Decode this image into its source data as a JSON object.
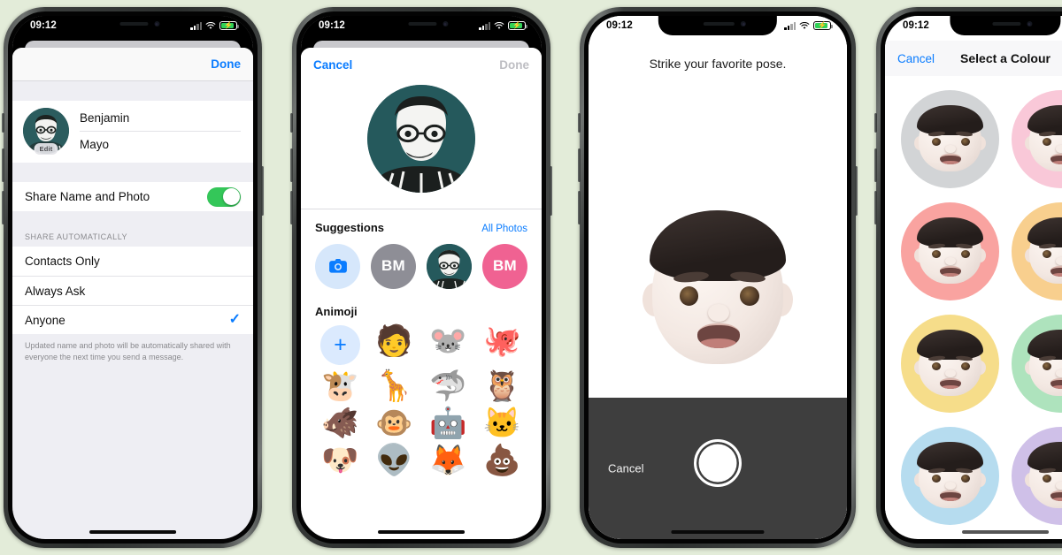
{
  "meta": {
    "background_color": "#e3ecd9"
  },
  "status_bar": {
    "time": "09:12",
    "signal": "signal-bars",
    "wifi": "wifi",
    "battery": "battery-charging"
  },
  "phone1": {
    "nav": {
      "done": "Done"
    },
    "profile": {
      "first_name": "Benjamin",
      "last_name": "Mayo",
      "edit_badge": "Edit"
    },
    "share_row": {
      "label": "Share Name and Photo",
      "toggle_state": "on",
      "toggle_color": "#34c759"
    },
    "section_header": "SHARE AUTOMATICALLY",
    "options": [
      {
        "label": "Contacts Only",
        "selected": false
      },
      {
        "label": "Always Ask",
        "selected": false
      },
      {
        "label": "Anyone",
        "selected": true
      }
    ],
    "footnote": "Updated name and photo will be automatically shared with everyone the next time you send a message."
  },
  "phone2": {
    "nav": {
      "cancel": "Cancel",
      "done": "Done"
    },
    "suggestions": {
      "title": "Suggestions",
      "link": "All Photos",
      "items": [
        {
          "type": "camera",
          "label": "",
          "color": "#d6e7fb"
        },
        {
          "type": "initials",
          "label": "BM",
          "color": "#8e8e96"
        },
        {
          "type": "photo",
          "label": "",
          "color": "#25595c"
        },
        {
          "type": "initials",
          "label": "BM",
          "color": "#f06292"
        }
      ]
    },
    "animoji": {
      "title": "Animoji",
      "items": [
        "plus",
        "🧑",
        "🐭",
        "🐙",
        "🐮",
        "🦒",
        "🦈",
        "🦉",
        "🐗",
        "🐵",
        "🤖",
        "🐱",
        "🐶",
        "👽",
        "🦊",
        "💩"
      ]
    }
  },
  "phone3": {
    "title": "Strike your favorite pose.",
    "cancel": "Cancel",
    "shutter": "shutter-button"
  },
  "phone4": {
    "nav": {
      "cancel": "Cancel",
      "title": "Select a Colour"
    },
    "swatches": [
      {
        "name": "grey",
        "color": "#d2d4d6"
      },
      {
        "name": "pink",
        "color": "#f9c8d8"
      },
      {
        "name": "salmon",
        "color": "#f9a3a0"
      },
      {
        "name": "orange",
        "color": "#f8cf8e"
      },
      {
        "name": "yellow",
        "color": "#f6dd8a"
      },
      {
        "name": "green",
        "color": "#aee3bd"
      },
      {
        "name": "blue",
        "color": "#b6dcef"
      },
      {
        "name": "purple",
        "color": "#cfc0e8"
      }
    ]
  }
}
